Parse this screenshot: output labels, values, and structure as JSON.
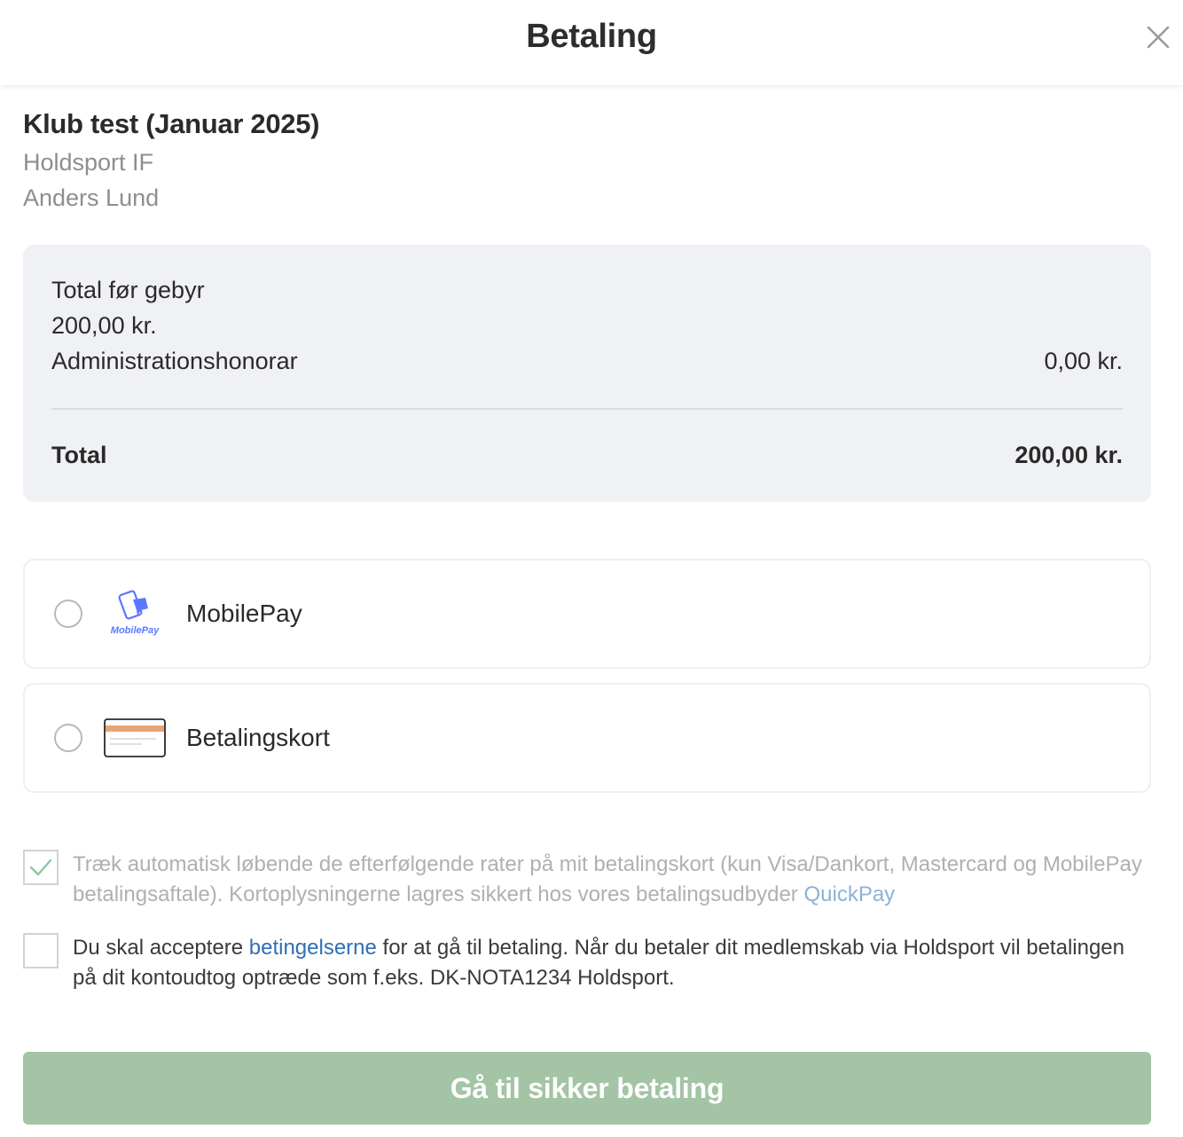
{
  "header": {
    "title": "Betaling"
  },
  "club": {
    "title": "Klub test (Januar 2025)",
    "organization": "Holdsport IF",
    "member": "Anders Lund"
  },
  "summary": {
    "subtotal_label": "Total før gebyr",
    "subtotal_value": "200,00 kr.",
    "fee_label": "Administrationshonorar",
    "fee_value": "0,00 kr.",
    "total_label": "Total",
    "total_value": "200,00 kr."
  },
  "payment_methods": [
    {
      "label": "MobilePay",
      "icon": "mobilepay-logo",
      "logo_text": "MobilePay",
      "selected": false
    },
    {
      "label": "Betalingskort",
      "icon": "credit-card-icon",
      "selected": false
    }
  ],
  "auto_charge": {
    "checked": true,
    "text": "Træk automatisk løbende de efterfølgende rater på mit betalingskort (kun Visa/Dankort, Mastercard og MobilePay betalingsaftale). Kortoplysningerne lagres sikkert hos vores betalingsudbyder ",
    "link": "QuickPay"
  },
  "terms": {
    "checked": false,
    "text_before": "Du skal acceptere ",
    "link": "betingelserne",
    "text_after": " for at gå til betaling. Når du betaler dit medlemskab via Holdsport vil betalingen på dit kontoudtog optræde som f.eks. DK-NOTA1234 Holdsport."
  },
  "submit": {
    "label": "Gå til sikker betaling"
  },
  "colors": {
    "submit_bg": "#a3c4a5",
    "link": "#2f6fb5",
    "summary_bg": "#f0f1f4",
    "mobilepay_blue": "#5a78ff",
    "card_stripe": "#e8a574"
  }
}
